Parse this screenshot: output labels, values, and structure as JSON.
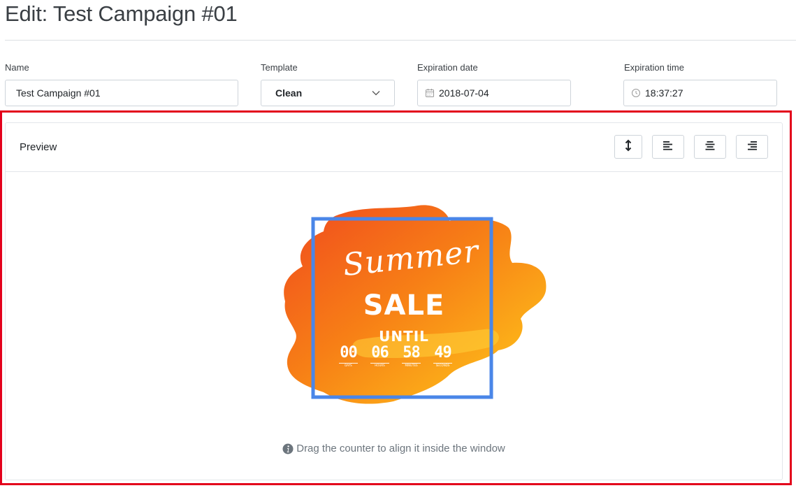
{
  "page": {
    "title": "Edit: Test Campaign #01"
  },
  "form": {
    "name": {
      "label": "Name",
      "value": "Test Campaign #01"
    },
    "template": {
      "label": "Template",
      "value": "Clean"
    },
    "expiration_date": {
      "label": "Expiration date",
      "value": "2018-07-04"
    },
    "expiration_time": {
      "label": "Expiration time",
      "value": "18:37:27"
    }
  },
  "preview": {
    "title": "Preview",
    "toolbar": [
      "vertical-resize-icon",
      "align-left-icon",
      "align-center-icon",
      "align-right-icon"
    ],
    "banner": {
      "script_text": "Summer",
      "headline": "SALE",
      "subheadline": "UNTIL",
      "counter": [
        {
          "value": "00",
          "caption": "DAYS"
        },
        {
          "value": "06",
          "caption": "HOURS"
        },
        {
          "value": "58",
          "caption": "MINUTES"
        },
        {
          "value": "49",
          "caption": "SECONDS"
        }
      ],
      "frame_color": "#4a86e8"
    },
    "hint": "Drag the counter to align it inside the window"
  },
  "colors": {
    "highlight": "#e3001b",
    "text": "#212529",
    "muted": "#6c757d"
  }
}
